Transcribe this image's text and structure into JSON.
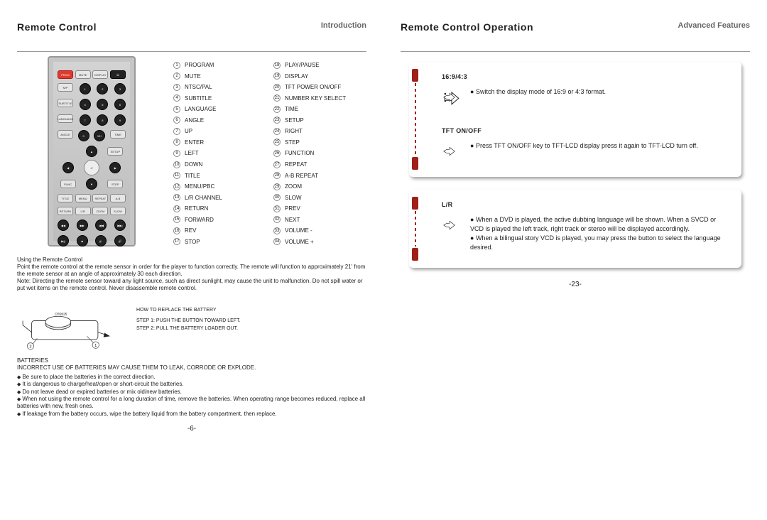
{
  "left": {
    "title": "Remote Control",
    "tag": "Introduction",
    "legend": [
      {
        "n": "1",
        "t": "PROGRAM"
      },
      {
        "n": "2",
        "t": "MUTE"
      },
      {
        "n": "3",
        "t": "NTSC/PAL"
      },
      {
        "n": "4",
        "t": "SUBTITLE"
      },
      {
        "n": "5",
        "t": "LANGUAGE"
      },
      {
        "n": "6",
        "t": "ANGLE"
      },
      {
        "n": "7",
        "t": "UP"
      },
      {
        "n": "8",
        "t": "ENTER"
      },
      {
        "n": "9",
        "t": "LEFT"
      },
      {
        "n": "10",
        "t": "DOWN"
      },
      {
        "n": "11",
        "t": "TITLE"
      },
      {
        "n": "12",
        "t": "MENU/PBC"
      },
      {
        "n": "13",
        "t": "L/R CHANNEL"
      },
      {
        "n": "14",
        "t": "RETURN"
      },
      {
        "n": "15",
        "t": "FORWARD"
      },
      {
        "n": "16",
        "t": "REV"
      },
      {
        "n": "17",
        "t": "STOP"
      },
      {
        "n": "18",
        "t": "PLAY/PAUSE"
      },
      {
        "n": "19",
        "t": "DISPLAY"
      },
      {
        "n": "20",
        "t": "TFT POWER ON/OFF"
      },
      {
        "n": "21",
        "t": "NUMBER KEY SELECT"
      },
      {
        "n": "22",
        "t": "TIME"
      },
      {
        "n": "23",
        "t": "SETUP"
      },
      {
        "n": "24",
        "t": "RIGHT"
      },
      {
        "n": "25",
        "t": "STEP"
      },
      {
        "n": "26",
        "t": "FUNCTION"
      },
      {
        "n": "27",
        "t": "REPEAT"
      },
      {
        "n": "28",
        "t": "A-B REPEAT"
      },
      {
        "n": "29",
        "t": "ZOOM"
      },
      {
        "n": "30",
        "t": "SLOW"
      },
      {
        "n": "31",
        "t": "PREV"
      },
      {
        "n": "32",
        "t": "NEXT"
      },
      {
        "n": "33",
        "t": "VOLUME -"
      },
      {
        "n": "34",
        "t": "VOLUME +"
      }
    ],
    "usage": {
      "h": "Using the Remote Control",
      "p1": "Point the remote control at the remote sensor in order for the player to function correctly. The remote will function to approximately 21' from the remote sensor at an angle of approximately 30 each direction.",
      "p2": "Note: Directing the remote sensor toward any light source, such as direct sunlight, may cause the unit to malfunction. Do not spill water or put wet items on the remote control. Never disassemble remote control."
    },
    "battery_label": "CR2025",
    "battery": {
      "h": "HOW TO REPLACE THE BATTERY",
      "s1": "STEP 1: PUSH THE BUTTON TOWARD LEFT.",
      "s2": "STEP 2: PULL THE BATTERY LOADER OUT."
    },
    "batteries_h": "BATTERIES",
    "batteries_warn": "INCORRECT USE OF BATTERIES MAY CAUSE THEM TO LEAK, CORRODE OR EXPLODE.",
    "batteries_items": [
      "Be sure to place the batteries in the correct direction.",
      "It is dangerous to charge/heat/open or short-circuit the batteries.",
      "Do not leave dead or expired batteries or mix old/new batteries.",
      "When not using the remote control for a long duration of time, remove the batteries. When operating range becomes reduced, replace all batteries with new, fresh ones.",
      "If leakage from the battery occurs, wipe the battery liquid from the battery compartment, then replace."
    ],
    "pagenum": "-6-"
  },
  "right": {
    "title": "Remote Control Operation",
    "tag": "Advanced Features",
    "panel1": {
      "sec1_h": "16:9/4:3",
      "sec1_t": "Switch the display mode of 16:9 or 4:3 format.",
      "sec2_h": "TFT ON/OFF",
      "sec2_t": "Press TFT ON/OFF key to TFT-LCD display press it again to TFT-LCD turn off."
    },
    "panel2": {
      "h": "L/R",
      "t1": "When  a  DVD  is played, the active dubbing language  will be shown. When a SVCD or VCD is played  the  left track, right track or stereo will be displayed accordingly.",
      "t2": "When  a  bilingual story VCD is played, you may  press  the button  to  select  the  language desired."
    },
    "pagenum": "-23-"
  }
}
